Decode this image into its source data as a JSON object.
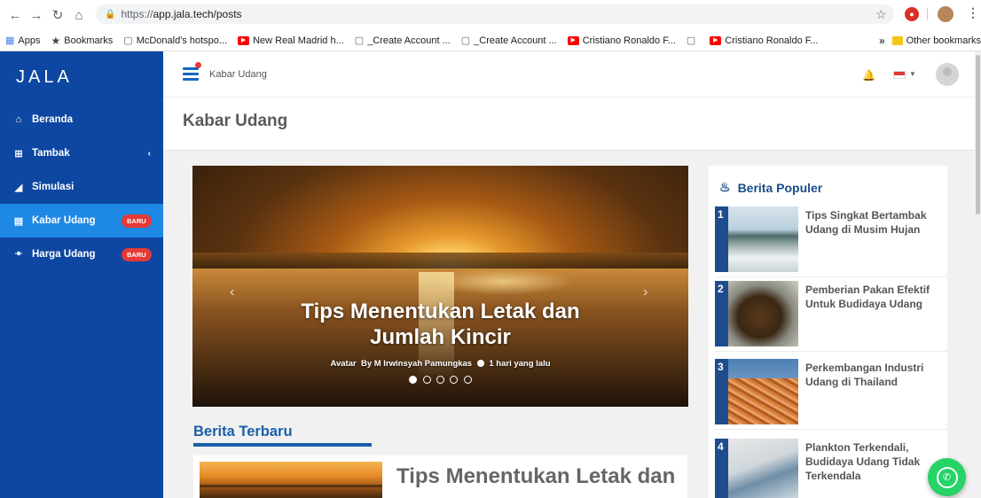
{
  "browser": {
    "url_proto": "https://",
    "url_rest": "app.jala.tech/posts",
    "bookmarks": [
      {
        "label": "Apps",
        "icon": "apps-grid-icon"
      },
      {
        "label": "Bookmarks",
        "icon": "star-icon"
      },
      {
        "label": "McDonald's hotspo...",
        "icon": "page-icon"
      },
      {
        "label": "New Real Madrid h...",
        "icon": "youtube-icon"
      },
      {
        "label": "_Create Account  ...",
        "icon": "page-icon"
      },
      {
        "label": "_Create Account  ...",
        "icon": "page-icon"
      },
      {
        "label": "Cristiano Ronaldo F...",
        "icon": "youtube-icon"
      },
      {
        "label": "",
        "icon": "page-icon"
      },
      {
        "label": "Cristiano Ronaldo F...",
        "icon": "youtube-icon"
      }
    ],
    "more": "»",
    "other_bookmarks": "Other bookmarks"
  },
  "sidebar": {
    "brand": "JALA",
    "items": [
      {
        "label": "Beranda",
        "icon": "home-icon"
      },
      {
        "label": "Tambak",
        "icon": "grid-icon",
        "caret": "‹"
      },
      {
        "label": "Simulasi",
        "icon": "chart-icon"
      },
      {
        "label": "Kabar Udang",
        "icon": "newspaper-icon",
        "badge": "BARU",
        "active": true
      },
      {
        "label": "Harga Udang",
        "icon": "shrimp-icon",
        "badge": "BARU"
      }
    ]
  },
  "header": {
    "breadcrumb": "Kabar Udang"
  },
  "page": {
    "title": "Kabar Udang"
  },
  "carousel": {
    "title": "Tips Menentukan Letak dan Jumlah Kincir",
    "avatar_alt": "Avatar",
    "author": "By M Irwinsyah Pamungkas",
    "time": "1 hari yang lalu",
    "slides": 5,
    "active_slide": 1,
    "prev": "‹",
    "next": "›"
  },
  "latest": {
    "heading": "Berita Terbaru",
    "first_title": "Tips Menentukan Letak dan"
  },
  "popular": {
    "heading": "Berita Populer",
    "items": [
      {
        "num": "1",
        "title": "Tips Singkat Bertambak Udang di Musim Hujan"
      },
      {
        "num": "2",
        "title": "Pemberian Pakan Efektif Untuk Budidaya Udang"
      },
      {
        "num": "3",
        "title": "Perkembangan Industri Udang di Thailand"
      },
      {
        "num": "4",
        "title": "Plankton Terkendali, Budidaya Udang Tidak Terkendala"
      }
    ]
  },
  "colors": {
    "sidebar": "#0d47a1",
    "sidebar_active": "#1e88e5",
    "badge": "#e53935",
    "accent": "#1a5fa8",
    "whatsapp": "#25d366"
  }
}
